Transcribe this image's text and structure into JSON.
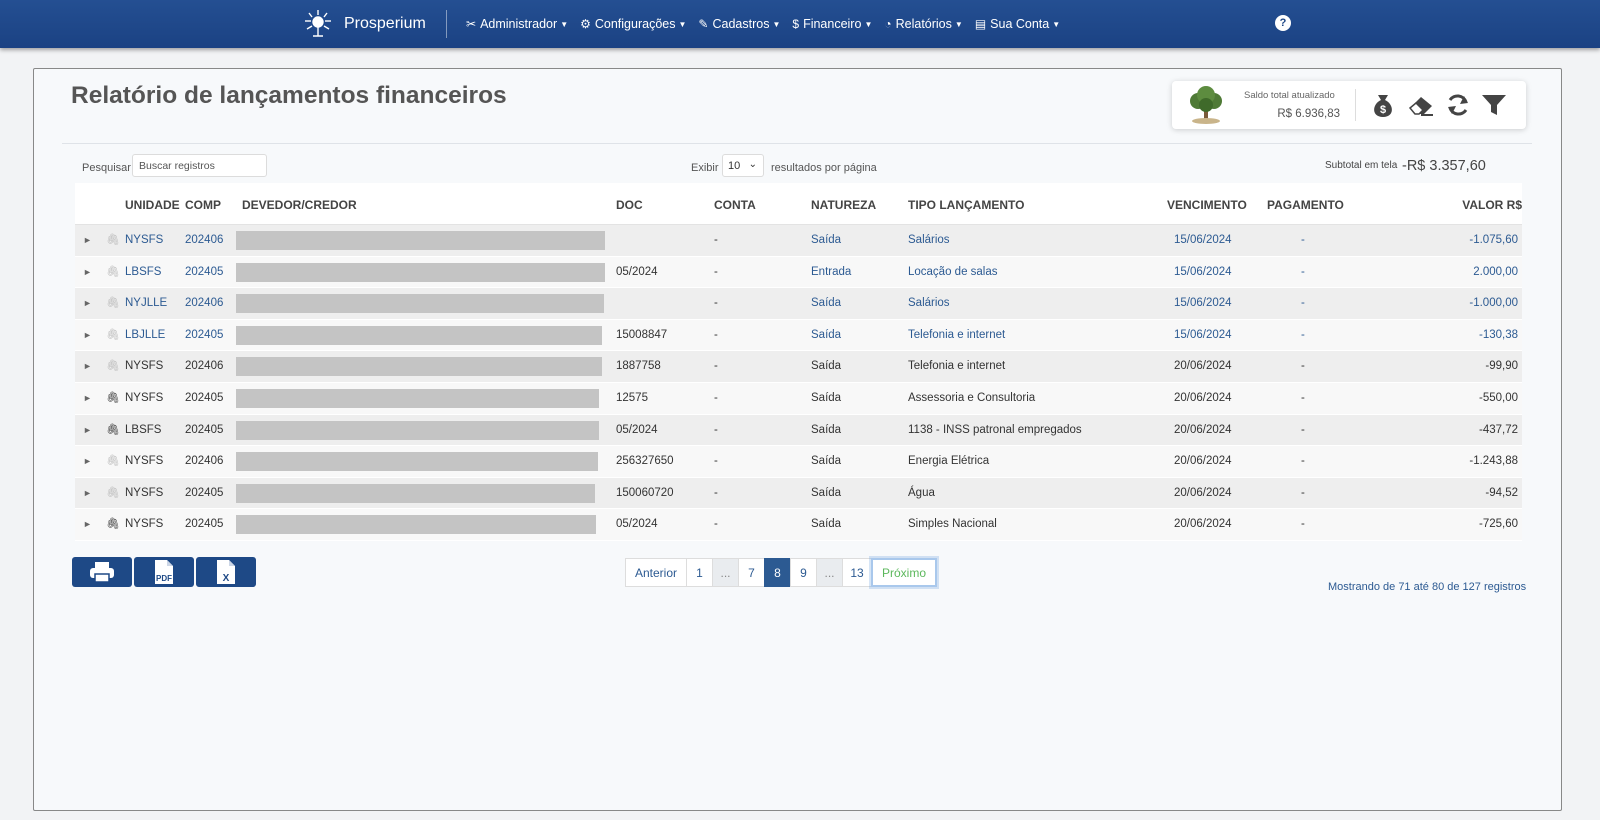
{
  "brand": {
    "name": "Prosperium"
  },
  "menu": [
    {
      "label": "Administrador",
      "icon": "✂"
    },
    {
      "label": "Configurações",
      "icon": "⚙"
    },
    {
      "label": "Cadastros",
      "icon": "✎"
    },
    {
      "label": "Financeiro",
      "icon": "$"
    },
    {
      "label": "Relatórios",
      "icon": "◔"
    },
    {
      "label": "Sua Conta",
      "icon": "▤"
    }
  ],
  "help": {
    "label": "?"
  },
  "page": {
    "title": "Relatório de lançamentos financeiros"
  },
  "balance": {
    "label": "Saldo total atualizado",
    "value": "R$ 6.936,83"
  },
  "toolbar_icons": [
    "money-bag-icon",
    "eraser-icon",
    "refresh-icon",
    "filter-icon"
  ],
  "search": {
    "label": "Pesquisar",
    "placeholder": "Buscar registros"
  },
  "page_size": {
    "label": "Exibir",
    "value": "10",
    "suffix": "resultados por página"
  },
  "subtotal": {
    "label": "Subtotal em tela",
    "value": "-R$ 3.357,60"
  },
  "table": {
    "headers": {
      "unidade": "UNIDADE",
      "comp": "COMP",
      "devedor": "DEVEDOR/CREDOR",
      "doc": "DOC",
      "conta": "CONTA",
      "natureza": "NATUREZA",
      "tipo": "TIPO LANÇAMENTO",
      "vencimento": "VENCIMENTO",
      "pagamento": "PAGAMENTO",
      "valor": "VALOR R$"
    },
    "rows": [
      {
        "unit": "NYSFS",
        "comp": "202406",
        "doc": "",
        "conta": "-",
        "nat": "Saída",
        "tipo": "Salários",
        "venc": "15/06/2024",
        "pag": "-",
        "valor": "-1.075,60",
        "link": true,
        "clip": false,
        "mask": 0.255
      },
      {
        "unit": "LBSFS",
        "comp": "202405",
        "doc": "05/2024",
        "conta": "-",
        "nat": "Entrada",
        "tipo": "Locação de salas",
        "venc": "15/06/2024",
        "pag": "-",
        "valor": "2.000,00",
        "link": true,
        "clip": false,
        "mask": 0.255
      },
      {
        "unit": "NYJLLE",
        "comp": "202406",
        "doc": "",
        "conta": "-",
        "nat": "Saída",
        "tipo": "Salários",
        "venc": "15/06/2024",
        "pag": "-",
        "valor": "-1.000,00",
        "link": true,
        "clip": false,
        "mask": 0.254
      },
      {
        "unit": "LBJLLE",
        "comp": "202405",
        "doc": "15008847",
        "conta": "-",
        "nat": "Saída",
        "tipo": "Telefonia e internet",
        "venc": "15/06/2024",
        "pag": "-",
        "valor": "-130,38",
        "link": true,
        "clip": false,
        "mask": 0.253
      },
      {
        "unit": "NYSFS",
        "comp": "202406",
        "doc": "1887758",
        "conta": "-",
        "nat": "Saída",
        "tipo": "Telefonia e internet",
        "venc": "20/06/2024",
        "pag": "-",
        "valor": "-99,90",
        "link": false,
        "clip": false,
        "mask": 0.253
      },
      {
        "unit": "NYSFS",
        "comp": "202405",
        "doc": "12575",
        "conta": "-",
        "nat": "Saída",
        "tipo": "Assessoria e Consultoria",
        "venc": "20/06/2024",
        "pag": "-",
        "valor": "-550,00",
        "link": false,
        "clip": true,
        "mask": 0.251
      },
      {
        "unit": "LBSFS",
        "comp": "202405",
        "doc": "05/2024",
        "conta": "-",
        "nat": "Saída",
        "tipo": "1138 - INSS patronal empregados",
        "venc": "20/06/2024",
        "pag": "-",
        "valor": "-437,72",
        "link": false,
        "clip": true,
        "mask": 0.251
      },
      {
        "unit": "NYSFS",
        "comp": "202406",
        "doc": "256327650",
        "conta": "-",
        "nat": "Saída",
        "tipo": "Energia Elétrica",
        "venc": "20/06/2024",
        "pag": "-",
        "valor": "-1.243,88",
        "link": false,
        "clip": false,
        "mask": 0.25
      },
      {
        "unit": "NYSFS",
        "comp": "202405",
        "doc": "150060720",
        "conta": "-",
        "nat": "Saída",
        "tipo": "Água",
        "venc": "20/06/2024",
        "pag": "-",
        "valor": "-94,52",
        "link": false,
        "clip": false,
        "mask": 0.248
      },
      {
        "unit": "NYSFS",
        "comp": "202405",
        "doc": "05/2024",
        "conta": "-",
        "nat": "Saída",
        "tipo": "Simples Nacional",
        "venc": "20/06/2024",
        "pag": "-",
        "valor": "-725,60",
        "link": false,
        "clip": true,
        "mask": 0.249
      }
    ]
  },
  "export": [
    {
      "name": "print",
      "label": ""
    },
    {
      "name": "pdf",
      "label": "PDF"
    },
    {
      "name": "excel",
      "label": "X"
    }
  ],
  "pagination": [
    "Anterior",
    "1",
    "...",
    "7",
    "8",
    "9",
    "...",
    "13",
    "Próximo"
  ],
  "pagination_active": "8",
  "record_info": "Mostrando de 71 até 80 de 127 registros",
  "colors": {
    "nav": "#1d4685",
    "link": "#2c5a92",
    "next": "#5cb85c"
  }
}
